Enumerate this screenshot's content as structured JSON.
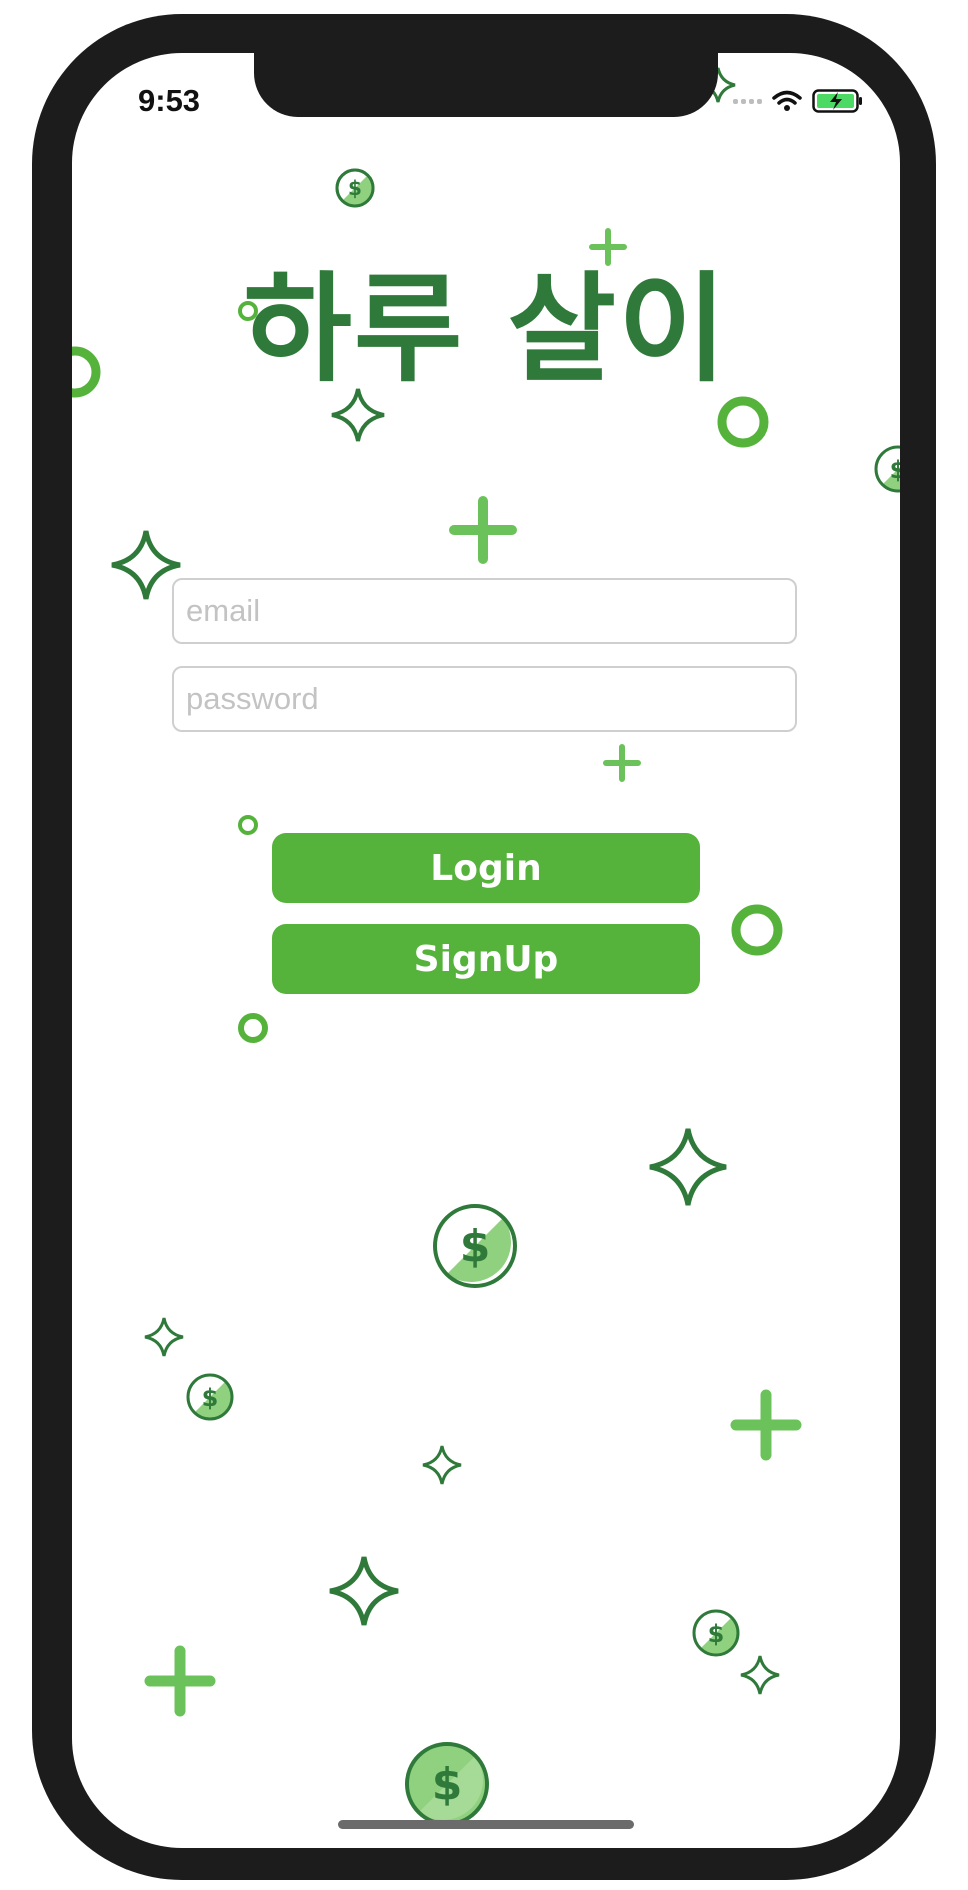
{
  "status_bar": {
    "time": "9:53"
  },
  "app": {
    "title": "하루 살이"
  },
  "form": {
    "email_placeholder": "email",
    "password_placeholder": "password"
  },
  "buttons": {
    "login": "Login",
    "signup": "SignUp"
  },
  "colors": {
    "frame": "#1c1c1c",
    "title": "#2f7a3a",
    "button": "#55b33c",
    "deco_dark": "#2f7a3a",
    "deco_light": "#6cc25a"
  },
  "background_icons": [
    "star-outline-icon",
    "plus-icon",
    "ring-icon",
    "coin-icon"
  ]
}
